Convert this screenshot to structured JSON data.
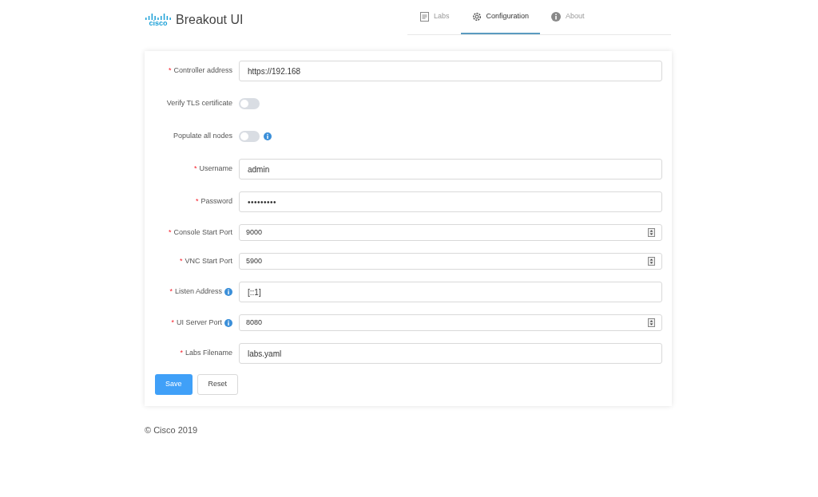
{
  "header": {
    "logo_text": "cisco",
    "title": "Breakout UI"
  },
  "tabs": [
    {
      "label": "Labs",
      "kind": "document",
      "selected": false
    },
    {
      "label": "Configuration",
      "kind": "gear",
      "selected": true
    },
    {
      "label": "About",
      "kind": "info",
      "selected": false
    }
  ],
  "form": {
    "fields": [
      {
        "kind": "text",
        "required_mark": "*",
        "label": "Controller address",
        "info": false,
        "value": "https://192.168"
      },
      {
        "kind": "switch",
        "label": "Verify TLS certificate",
        "info": false,
        "on": false
      },
      {
        "kind": "switch",
        "label": "Populate all nodes",
        "info": true,
        "on": false
      },
      {
        "kind": "text",
        "required_mark": "*",
        "label": "Username",
        "info": false,
        "value": "admin"
      },
      {
        "kind": "password",
        "required_mark": "*",
        "label": "Password",
        "info": false,
        "value": "•••••••••"
      },
      {
        "kind": "number",
        "required_mark": "*",
        "label": "Console Start Port",
        "info": false,
        "value": "9000"
      },
      {
        "kind": "number",
        "required_mark": "*",
        "label": "VNC Start Port",
        "info": false,
        "value": "5900"
      },
      {
        "kind": "text",
        "required_mark": "*",
        "label": "Listen Address",
        "info": true,
        "value": "[::1]"
      },
      {
        "kind": "number",
        "required_mark": "*",
        "label": "UI Server Port",
        "info": true,
        "value": "8080"
      },
      {
        "kind": "text",
        "required_mark": "*",
        "label": "Labs Filename",
        "info": false,
        "value": "labs.yaml"
      }
    ],
    "buttons": [
      {
        "label": "Save",
        "kind": "primary"
      },
      {
        "label": "Reset",
        "kind": "default"
      }
    ]
  },
  "footer": "© Cisco 2019"
}
